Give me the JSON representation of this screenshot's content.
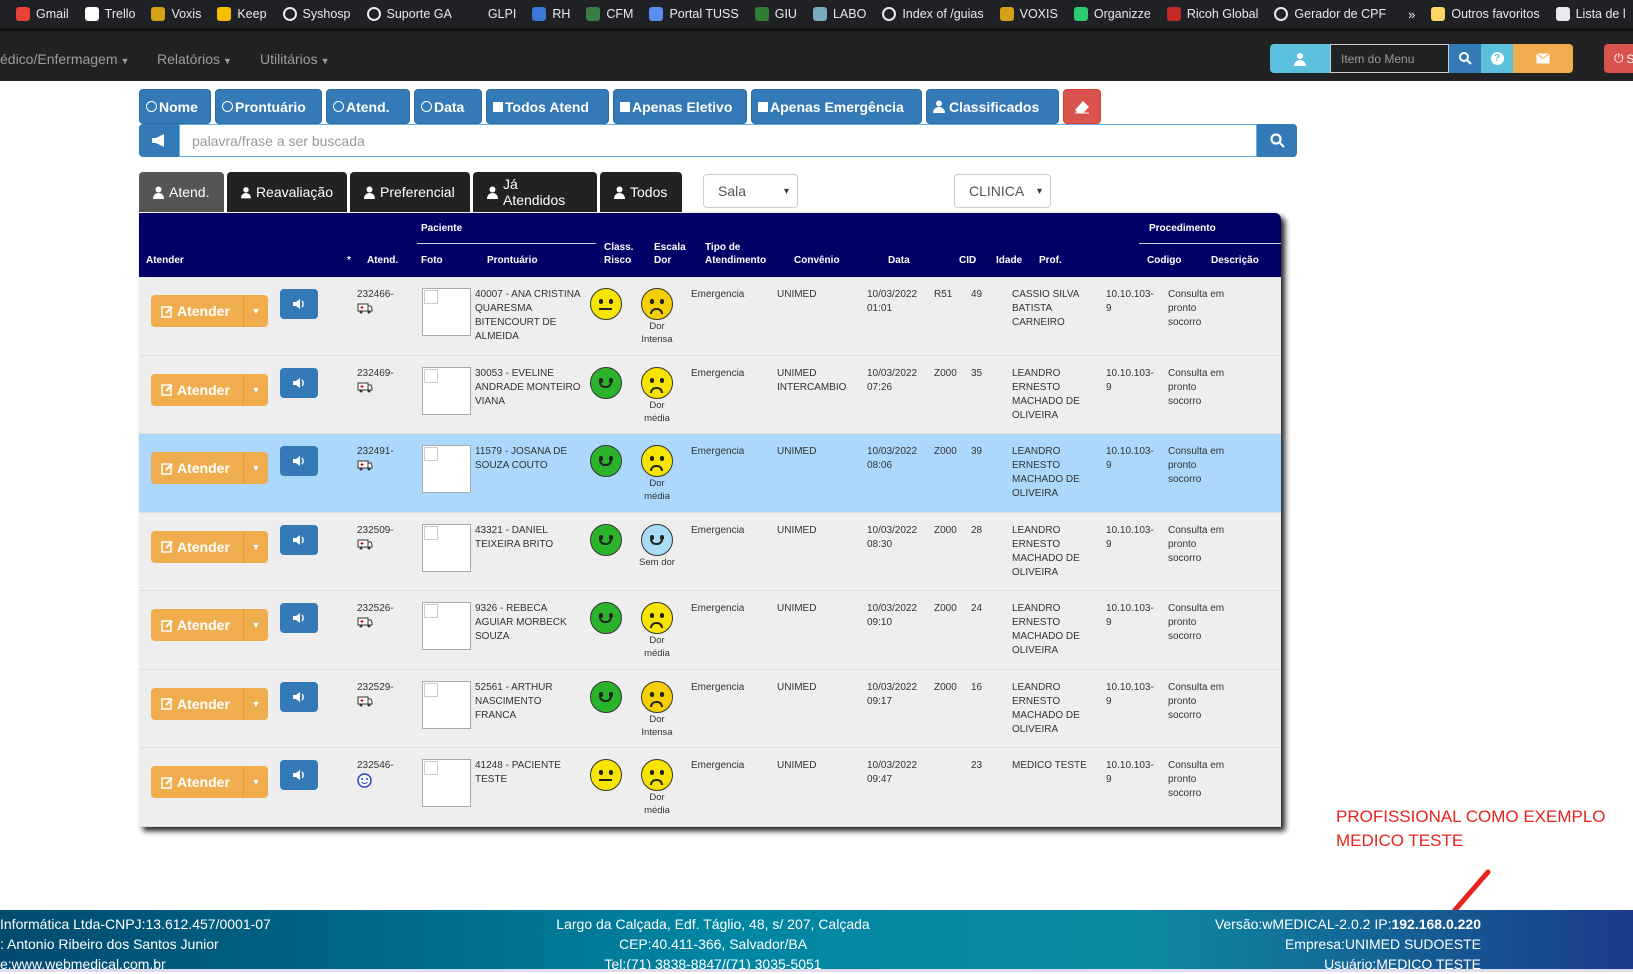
{
  "bookmarks": [
    {
      "label": "Gmail",
      "icon": "gmail-icon",
      "color": "#ea4335"
    },
    {
      "label": "Trello",
      "icon": "trello-icon",
      "color": "#ffffff"
    },
    {
      "label": "Voxis",
      "icon": "voxis-icon",
      "color": "#d4a017"
    },
    {
      "label": "Keep",
      "icon": "keep-icon",
      "color": "#fbbc04"
    },
    {
      "label": "Syshosp",
      "icon": "globe-icon",
      "color": "#e8eaed"
    },
    {
      "label": "Suporte GA",
      "icon": "globe-icon",
      "color": "#e8eaed"
    },
    {
      "label": "GLPI",
      "icon": "glpi-icon",
      "color": "#202124"
    },
    {
      "label": "RH",
      "icon": "rh-icon",
      "color": "#3c78d8"
    },
    {
      "label": "CFM",
      "icon": "cfm-icon",
      "color": "#3a7d44"
    },
    {
      "label": "Portal TUSS",
      "icon": "tuss-icon",
      "color": "#5b8def"
    },
    {
      "label": "GIU",
      "icon": "giu-icon",
      "color": "#2e7d32"
    },
    {
      "label": "LABO",
      "icon": "labo-icon",
      "color": "#7ab"
    },
    {
      "label": "Index of /guias",
      "icon": "globe-icon",
      "color": "#e8eaed"
    },
    {
      "label": "VOXIS",
      "icon": "voxis-icon",
      "color": "#d4a017"
    },
    {
      "label": "Organizze",
      "icon": "organizze-icon",
      "color": "#2ecc71"
    },
    {
      "label": "Ricoh Global",
      "icon": "ricoh-icon",
      "color": "#c62828"
    },
    {
      "label": "Gerador de CPF",
      "icon": "globe-icon",
      "color": "#e8eaed"
    }
  ],
  "bookmarks_more": "»",
  "bookmarks_right": [
    {
      "label": "Outros favoritos",
      "icon": "folder-icon",
      "color": "#fdd663"
    },
    {
      "label": "Lista de l",
      "icon": "reading-list-icon",
      "color": "#e8eaed"
    }
  ],
  "navbar": {
    "menus": [
      "édico/Enfermagem",
      "Relatórios",
      "Utilitários"
    ],
    "menu_search_placeholder": "Item do Menu",
    "logout_label": "S"
  },
  "filters": [
    "Nome",
    "Prontuário",
    "Atend.",
    "Data",
    "Todos Atend",
    "Apenas Eletivo",
    "Apenas Emergência",
    "Classificados"
  ],
  "search_placeholder": "palavra/frase a ser buscada",
  "tabs": [
    "Atend.",
    "Reavaliação",
    "Preferencial",
    "Já Atendidos",
    "Todos"
  ],
  "sala_select": "Sala",
  "clinica_select": "CLINICA",
  "table": {
    "group_paciente": "Paciente",
    "group_procedimento": "Procedimento",
    "headers": {
      "atender": "Atender",
      "star": "*",
      "atend": "Atend.",
      "foto": "Foto",
      "prontuario": "Prontuário",
      "class_risco_1": "Class.",
      "class_risco_2": "Risco",
      "escala_dor_1": "Escala",
      "escala_dor_2": "Dor",
      "tipo_1": "Tipo de",
      "tipo_2": "Atendimento",
      "convenio": "Convênio",
      "data": "Data",
      "cid": "CID",
      "idade": "Idade",
      "prof": "Prof.",
      "codigo": "Codigo",
      "descricao": "Descrição"
    },
    "atender_label": "Atender",
    "rows": [
      {
        "atend": "232466-",
        "arrival": "ambulance-icon",
        "patient": "40007 - ANA CRISTINA QUARESMA BITENCOURT DE ALMEIDA",
        "risk_color": "#f7e400",
        "risk_face": "flat",
        "pain_color": "#f5d000",
        "pain_face": "frown",
        "pain_label": "Dor Intensa",
        "tipo": "Emergencia",
        "convenio": "UNIMED",
        "data": "10/03/2022 01:01",
        "cid": "R51",
        "idade": "49",
        "prof": "CASSIO SILVA BATISTA CARNEIRO",
        "codigo": "10.10.103-9",
        "descricao": "Consulta em pronto socorro",
        "selected": false
      },
      {
        "atend": "232469-",
        "arrival": "ambulance-icon",
        "patient": "30053 - EVELINE ANDRADE MONTEIRO VIANA",
        "risk_color": "#2bb32b",
        "risk_face": "smile",
        "pain_color": "#f7e400",
        "pain_face": "frown",
        "pain_label": "Dor média",
        "tipo": "Emergencia",
        "convenio": "UNIMED INTERCAMBIO",
        "data": "10/03/2022 07:26",
        "cid": "Z000",
        "idade": "35",
        "prof": "LEANDRO ERNESTO MACHADO DE OLIVEIRA",
        "codigo": "10.10.103-9",
        "descricao": "Consulta em pronto socorro",
        "selected": false
      },
      {
        "atend": "232491-",
        "arrival": "ambulance-icon",
        "patient": "11579 - JOSANA DE SOUZA COUTO",
        "risk_color": "#2bb32b",
        "risk_face": "smile",
        "pain_color": "#f7e400",
        "pain_face": "frown",
        "pain_label": "Dor média",
        "tipo": "Emergencia",
        "convenio": "UNIMED",
        "data": "10/03/2022 08:06",
        "cid": "Z000",
        "idade": "39",
        "prof": "LEANDRO ERNESTO MACHADO DE OLIVEIRA",
        "codigo": "10.10.103-9",
        "descricao": "Consulta em pronto socorro",
        "selected": true
      },
      {
        "atend": "232509-",
        "arrival": "ambulance-icon",
        "patient": "43321 - DANIEL TEIXEIRA BRITO",
        "risk_color": "#2bb32b",
        "risk_face": "smile",
        "pain_color": "#a8dcf5",
        "pain_face": "smile",
        "pain_label": "Sem dor",
        "tipo": "Emergencia",
        "convenio": "UNIMED",
        "data": "10/03/2022 08:30",
        "cid": "Z000",
        "idade": "28",
        "prof": "LEANDRO ERNESTO MACHADO DE OLIVEIRA",
        "codigo": "10.10.103-9",
        "descricao": "Consulta em pronto socorro",
        "selected": false
      },
      {
        "atend": "232526-",
        "arrival": "ambulance-icon",
        "patient": "9326 - REBECA AGUIAR MORBECK SOUZA",
        "risk_color": "#2bb32b",
        "risk_face": "smile",
        "pain_color": "#f7e400",
        "pain_face": "frown",
        "pain_label": "Dor média",
        "tipo": "Emergencia",
        "convenio": "UNIMED",
        "data": "10/03/2022 09:10",
        "cid": "Z000",
        "idade": "24",
        "prof": "LEANDRO ERNESTO MACHADO DE OLIVEIRA",
        "codigo": "10.10.103-9",
        "descricao": "Consulta em pronto socorro",
        "selected": false
      },
      {
        "atend": "232529-",
        "arrival": "ambulance-icon",
        "patient": "52561 - ARTHUR NASCIMENTO FRANCA",
        "risk_color": "#2bb32b",
        "risk_face": "smile",
        "pain_color": "#f5d000",
        "pain_face": "frown",
        "pain_label": "Dor Intensa",
        "tipo": "Emergencia",
        "convenio": "UNIMED",
        "data": "10/03/2022 09:17",
        "cid": "Z000",
        "idade": "16",
        "prof": "LEANDRO ERNESTO MACHADO DE OLIVEIRA",
        "codigo": "10.10.103-9",
        "descricao": "Consulta em pronto socorro",
        "selected": false
      },
      {
        "atend": "232546-",
        "arrival": "walk-in-smiley-icon",
        "patient": "41248 - PACIENTE TESTE",
        "risk_color": "#f7e400",
        "risk_face": "flat",
        "pain_color": "#f7e400",
        "pain_face": "frown",
        "pain_label": "Dor média",
        "tipo": "Emergencia",
        "convenio": "UNIMED",
        "data": "10/03/2022 09:47",
        "cid": "",
        "idade": "23",
        "prof": "MEDICO TESTE",
        "codigo": "10.10.103-9",
        "descricao": "Consulta em pronto socorro",
        "selected": false
      }
    ]
  },
  "annotation": {
    "line1": "PROFISSIONAL COMO EXEMPLO",
    "line2": "MEDICO TESTE",
    "color": "#e8231f"
  },
  "footer": {
    "left": [
      "Informática Ltda-CNPJ:13.612.457/0001-07",
      ": Antonio Ribeiro dos Santos Junior",
      "e:www.webmedical.com.br"
    ],
    "center": [
      "Largo da Calçada, Edf. Táglio, 48, s/ 207, Calçada",
      "CEP:40.411-366, Salvador/BA",
      "Tel:(71) 3838-8847/(71) 3035-5051"
    ],
    "version_prefix": "Versão:wMEDICAL-2.0.2 IP:",
    "ip": "192.168.0.220",
    "empresa": "Empresa:UNIMED SUDOESTE",
    "usuario": "Usuário:MEDICO TESTE"
  }
}
